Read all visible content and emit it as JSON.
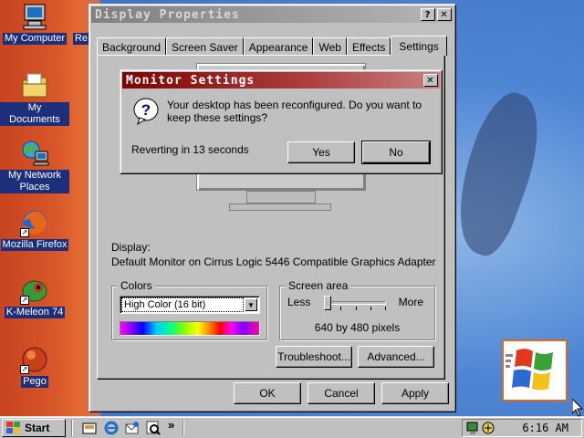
{
  "desktop": {
    "icons": [
      {
        "label": "My Computer",
        "icon": "my-computer-icon"
      },
      {
        "label": "My Documents",
        "icon": "my-documents-icon"
      },
      {
        "label": "My Network Places",
        "icon": "network-places-icon"
      },
      {
        "label": "Mozilla Firefox",
        "icon": "firefox-icon"
      },
      {
        "label": "K-Meleon 74",
        "icon": "k-meleon-icon"
      },
      {
        "label": "Pego",
        "icon": "pego-icon"
      },
      {
        "label": "Re",
        "icon": "recycle-bin-icon"
      }
    ]
  },
  "display_properties": {
    "title": "Display Properties",
    "tabs": [
      "Background",
      "Screen Saver",
      "Appearance",
      "Web",
      "Effects",
      "Settings"
    ],
    "active_tab": "Settings",
    "display_label": "Display:",
    "display_value": "Default Monitor on Cirrus Logic 5446 Compatible Graphics Adapter",
    "colors": {
      "legend": "Colors",
      "selected": "High Color (16 bit)"
    },
    "screen_area": {
      "legend": "Screen area",
      "less": "Less",
      "more": "More",
      "value_text": "640 by 480 pixels",
      "slider_level": 0
    },
    "troubleshoot_label": "Troubleshoot...",
    "advanced_label": "Advanced...",
    "ok_label": "OK",
    "cancel_label": "Cancel",
    "apply_label": "Apply",
    "help_glyph": "?",
    "close_glyph": "✕"
  },
  "monitor_settings": {
    "title": "Monitor Settings",
    "message": "Your desktop has been reconfigured.  Do you want to keep these settings?",
    "countdown": "Reverting in 13 seconds",
    "yes_label": "Yes",
    "no_label": "No",
    "close_glyph": "✕",
    "question_glyph": "?"
  },
  "taskbar": {
    "start_label": "Start",
    "overflow_glyph": "»",
    "clock": "6:16 AM",
    "accent": "#000080"
  },
  "colors": {
    "title_active": "#800000",
    "title_inactive": "#808080",
    "face": "#c0c0c0"
  }
}
